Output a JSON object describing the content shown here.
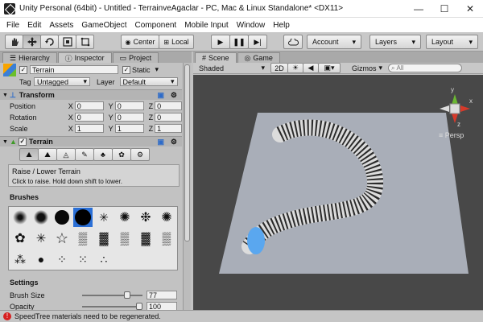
{
  "window": {
    "title": "Unity Personal (64bit) - Untitled - TerrainveAgaclar - PC, Mac & Linux Standalone* <DX11>",
    "minimize": "—",
    "maximize": "☐",
    "close": "✕"
  },
  "menu": [
    "File",
    "Edit",
    "Assets",
    "GameObject",
    "Component",
    "Mobile Input",
    "Window",
    "Help"
  ],
  "toolbar": {
    "center": "Center",
    "local": "Local",
    "account": "Account",
    "layers": "Layers",
    "layout": "Layout"
  },
  "left_tabs": [
    "Hierarchy",
    "Inspector",
    "Project"
  ],
  "inspector": {
    "object_name": "Terrain",
    "static_label": "Static",
    "tag_label": "Tag",
    "tag_value": "Untagged",
    "layer_label": "Layer",
    "layer_value": "Default",
    "transform": {
      "title": "Transform",
      "rows": [
        {
          "label": "Position",
          "x": "0",
          "y": "0",
          "z": "0"
        },
        {
          "label": "Rotation",
          "x": "0",
          "y": "0",
          "z": "0"
        },
        {
          "label": "Scale",
          "x": "1",
          "y": "1",
          "z": "1"
        }
      ]
    },
    "terrain": {
      "title": "Terrain",
      "tool_title": "Raise / Lower Terrain",
      "tool_help": "Click to raise. Hold down shift to lower.",
      "brushes_label": "Brushes",
      "settings_label": "Settings",
      "brush_size_label": "Brush Size",
      "brush_size_value": "77",
      "brush_size_fraction": 0.77,
      "opacity_label": "Opacity",
      "opacity_value": "100",
      "opacity_fraction": 1.0
    }
  },
  "scene": {
    "tabs": [
      "Scene",
      "Game"
    ],
    "shading": "Shaded",
    "mode_2d": "2D",
    "gizmos": "Gizmos",
    "search_placeholder": "All",
    "persp_label": "Persp",
    "axis_labels": {
      "y": "y",
      "x": "x",
      "z": "z"
    }
  },
  "status": {
    "message": "SpeedTree materials need to be regenerated."
  }
}
